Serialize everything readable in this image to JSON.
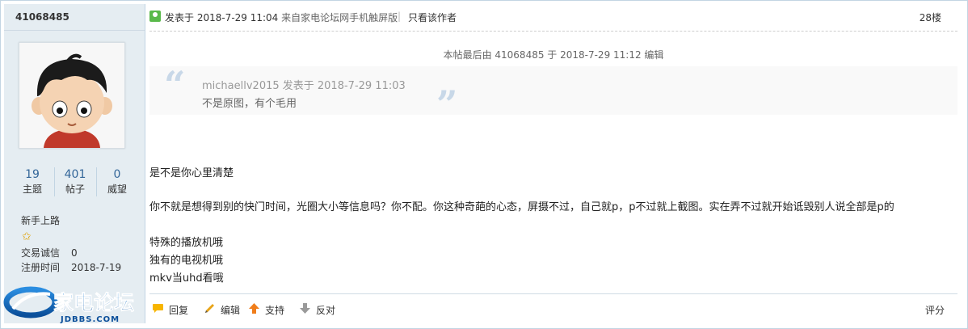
{
  "author": {
    "username": "41068485",
    "stats": [
      {
        "value": "19",
        "label": "主题"
      },
      {
        "value": "401",
        "label": "帖子"
      },
      {
        "value": "0",
        "label": "威望"
      }
    ],
    "rank": "新手上路",
    "trade_label": "交易诚信",
    "trade_value": "0",
    "reg_label": "注册时间",
    "reg_value": "2018-7-19"
  },
  "logo": {
    "cn": "家电论坛",
    "en": "JDBBS.COM"
  },
  "post": {
    "posted_at": "发表于 2018-7-29 11:04",
    "source": "来自家电论坛网手机触屏版",
    "separator": "|",
    "author_only": "只看该作者",
    "floor": "28楼",
    "edited": "本帖最后由 41068485 于 2018-7-29 11:12 编辑",
    "quote": {
      "open_mark": "“",
      "close_mark": "”",
      "header": "michaellv2015 发表于 2018-7-29 11:03",
      "body": "不是原图，有个毛用"
    },
    "lines": [
      "是不是你心里清楚",
      "你不就是想得到别的快门时间，光圈大小等信息吗？你不配。你这种奇葩的心态，屏摄不过，自己就p，p不过就上截图。实在弄不过就开始诋毁别人说全部是p的",
      "特殊的播放机哦",
      "独有的电视机哦",
      "mkv当uhd看哦"
    ]
  },
  "actions": {
    "reply": "回复",
    "edit": "编辑",
    "support": "支持",
    "oppose": "反对",
    "rate": "评分"
  },
  "colors": {
    "accent": "#336699",
    "sidebar_bg": "#e5edf2",
    "border": "#c2d5e3"
  }
}
